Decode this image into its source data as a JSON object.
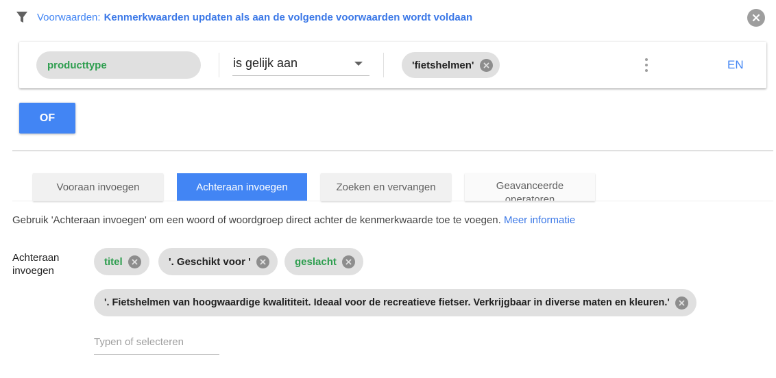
{
  "conditions": {
    "prefix": "Voorwaarden:",
    "description": "Kenmerkwaarden updaten als aan de volgende voorwaarden wordt voldaan",
    "row": {
      "attribute": "producttype",
      "operator": "is gelijk aan",
      "value_chip": "'fietshelmen'",
      "and_label": "EN"
    },
    "or_button": "OF"
  },
  "tabs": [
    {
      "label": "Vooraan invoegen",
      "active": false
    },
    {
      "label": "Achteraan invoegen",
      "active": true
    },
    {
      "label": "Zoeken en vervangen",
      "active": false
    },
    {
      "label": "Geavanceerde operatoren",
      "active": false
    }
  ],
  "help": {
    "text": "Gebruik 'Achteraan invoegen' om een woord of woordgroep direct achter de kenmerkwaarde toe te voegen. ",
    "link": "Meer informatie"
  },
  "append": {
    "label": "Achteraan invoegen",
    "chips": [
      {
        "text": "titel",
        "kind": "attribute"
      },
      {
        "text": "'. Geschikt voor '",
        "kind": "text"
      },
      {
        "text": "geslacht",
        "kind": "attribute"
      },
      {
        "text": "'. Fietshelmen van hoogwaardige kwalititeit. Ideaal voor de recreatieve fietser. Verkrijgbaar in diverse maten en kleuren.'",
        "kind": "text"
      }
    ],
    "input_placeholder": "Typen of selecteren"
  },
  "icons": {
    "filter": "filter-icon",
    "close": "close-circle-icon",
    "dropdown": "arrow-drop-down-icon",
    "more": "more-vert-icon"
  },
  "colors": {
    "accent": "#4285f4",
    "attribute_green": "#2e9e4f",
    "chip_bg": "#e0e0e0"
  }
}
